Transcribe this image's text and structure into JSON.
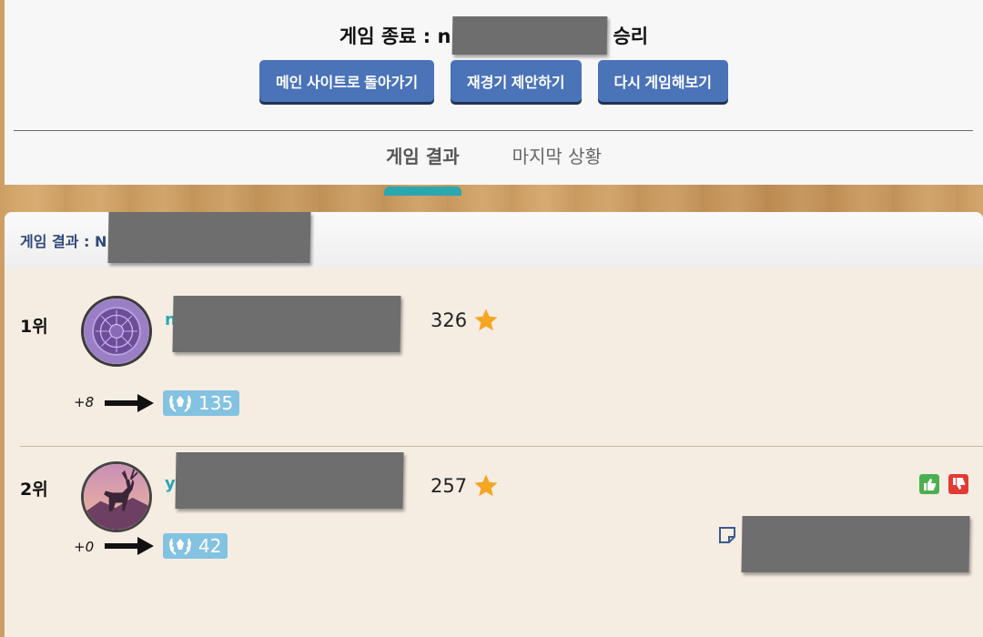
{
  "header": {
    "title_prefix": "게임 종료 : n",
    "title_suffix": "승리",
    "buttons": {
      "main_site": "메인 사이트로 돌아가기",
      "rematch": "재경기 제안하기",
      "play_again": "다시 게임해보기"
    },
    "tabs": {
      "results": "게임 결과",
      "last_state": "마지막 상황"
    }
  },
  "results": {
    "header_label": "게임 결과 : N",
    "players": [
      {
        "rank": "1위",
        "name_prefix": "n",
        "score": "326",
        "delta": "+8",
        "elo": "135"
      },
      {
        "rank": "2위",
        "name_prefix": "y",
        "score": "257",
        "delta": "+0",
        "elo": "42"
      }
    ]
  },
  "colors": {
    "button_blue": "#4a73b8",
    "tab_accent": "#2aa7b1",
    "elo_badge": "#84c2e2",
    "star": "#f5a623",
    "thumb_up": "#4caf50",
    "thumb_down": "#e53935"
  },
  "icons": [
    "star-icon",
    "arrow-right-icon",
    "laurel-icon",
    "thumb-up-icon",
    "thumb-down-icon",
    "note-icon"
  ]
}
